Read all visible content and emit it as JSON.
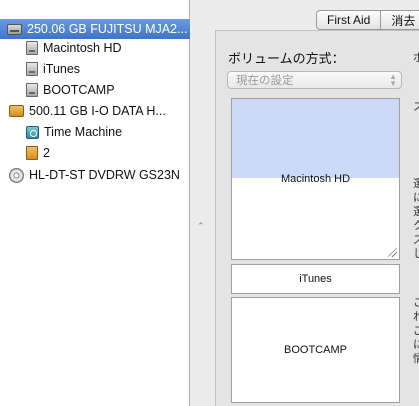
{
  "sidebar": {
    "items": [
      {
        "label": "250.06 GB FUJITSU MJA2...",
        "icon": "internal-disk-icon",
        "indent": 0,
        "selected": true
      },
      {
        "label": "Macintosh HD",
        "icon": "volume-icon",
        "indent": 1,
        "selected": false
      },
      {
        "label": "iTunes",
        "icon": "volume-icon",
        "indent": 1,
        "selected": false
      },
      {
        "label": "BOOTCAMP",
        "icon": "volume-icon",
        "indent": 1,
        "selected": false
      },
      {
        "label": "500.11 GB I-O DATA H...",
        "icon": "external-disk-icon",
        "indent": 0,
        "selected": false
      },
      {
        "label": "Time Machine",
        "icon": "time-machine-volume-icon",
        "indent": 1,
        "selected": false
      },
      {
        "label": "2",
        "icon": "external-volume-icon",
        "indent": 1,
        "selected": false
      },
      {
        "label": "HL-DT-ST DVDRW GS23N",
        "icon": "dvd-drive-icon",
        "indent": 0,
        "selected": false
      }
    ]
  },
  "tabs": [
    {
      "label": "First Aid"
    },
    {
      "label": "消去"
    }
  ],
  "partition": {
    "heading": "ボリュームの方式：",
    "scheme_select": {
      "value": "現在の設定"
    },
    "volumes": [
      {
        "name": "Macintosh HD",
        "used_fraction": 0.49
      },
      {
        "name": "iTunes"
      },
      {
        "name": "BOOTCAMP"
      }
    ]
  },
  "clipped_text": [
    {
      "text": "ボ"
    },
    {
      "text": "ス"
    },
    {
      "text": "選"
    },
    {
      "text": "に"
    },
    {
      "text": "選"
    },
    {
      "text": "ク"
    },
    {
      "text": "ズ"
    },
    {
      "text": "し"
    },
    {
      "text": "こ"
    },
    {
      "text": "れ"
    },
    {
      "text": "ご"
    },
    {
      "text": "に"
    },
    {
      "text": "情"
    }
  ],
  "colors": {
    "selection": "#3d73cc",
    "used_space": "#ccd9f7"
  }
}
